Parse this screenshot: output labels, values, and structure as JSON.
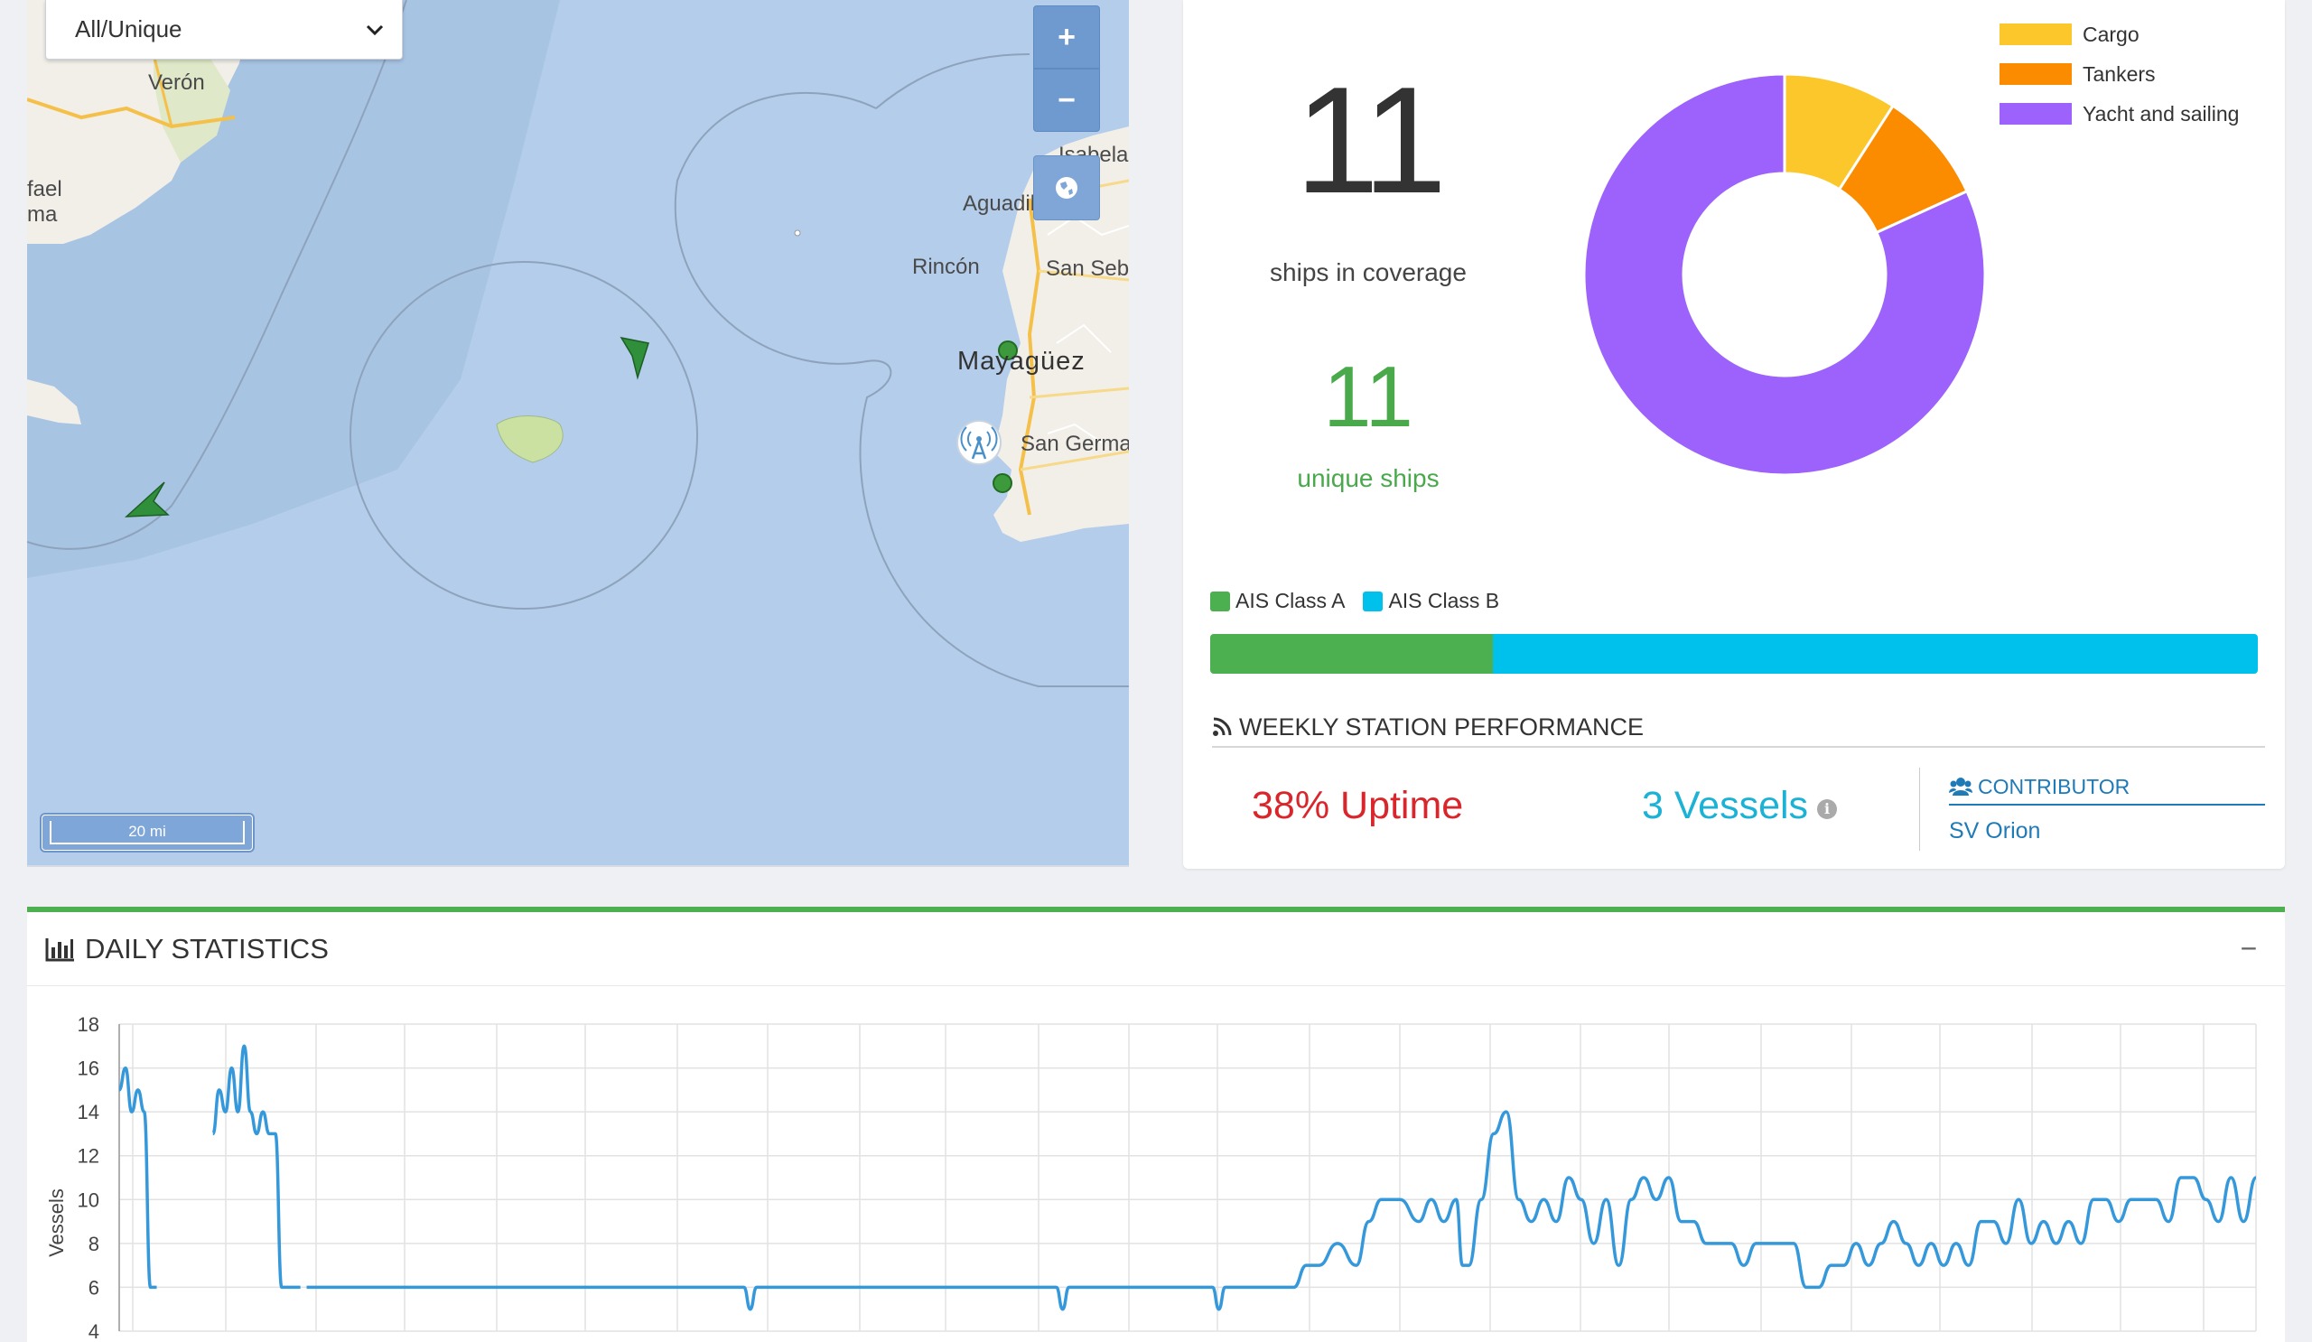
{
  "map": {
    "filter": {
      "selected": "All/Unique"
    },
    "zoom_in_label": "+",
    "zoom_out_label": "−",
    "scale_label": "20 mi",
    "place_labels": {
      "veron": "Verón",
      "fael": "fael",
      "ma": "ma",
      "isabela": "Isabela",
      "aguadilla": "Aguadilla",
      "rincon": "Rincón",
      "san_seb": "San Seb",
      "mayaguez": "Mayagüez",
      "san_germ": "San Germa"
    },
    "colors": {
      "water": "#b3cdeb",
      "land": "#f2efe9",
      "vessel": "#3c9a3c"
    }
  },
  "coverage": {
    "ships_count": "11",
    "ships_label": "ships in coverage",
    "unique_count": "11",
    "unique_label": "unique ships"
  },
  "vessel_types": {
    "legend": [
      {
        "label": "Cargo",
        "color": "#fcc72a"
      },
      {
        "label": "Tankers",
        "color": "#fb8c00"
      },
      {
        "label": "Yacht and sailing",
        "color": "#9d62fb"
      }
    ],
    "values": [
      1,
      1,
      9
    ]
  },
  "ais_classes": {
    "class_a": {
      "label": "AIS Class A",
      "color": "#4caf50",
      "fraction": 0.27
    },
    "class_b": {
      "label": "AIS Class B",
      "color": "#00c0ec",
      "fraction": 0.73
    }
  },
  "performance": {
    "title": "WEEKLY STATION PERFORMANCE",
    "uptime": "38% Uptime",
    "vessels": "3 Vessels",
    "contributor_title": "CONTRIBUTOR",
    "contributor_name": "SV Orion"
  },
  "daily": {
    "title": "DAILY STATISTICS",
    "collapse_label": "−"
  },
  "chart_data": {
    "type": "line",
    "title": "",
    "xlabel": "",
    "ylabel": "Vessels",
    "ylim": [
      4,
      18
    ],
    "yticks": [
      4,
      6,
      8,
      10,
      12,
      14,
      16,
      18
    ],
    "grid": true,
    "color": "#3498db",
    "series": [
      {
        "x": [
          0,
          1,
          2,
          3,
          4,
          5,
          6
        ],
        "y": [
          15,
          16,
          14,
          15,
          14,
          6,
          6
        ]
      },
      {
        "x": [
          15,
          16,
          17,
          18,
          19,
          20,
          21,
          22,
          23,
          24,
          25,
          26,
          27,
          28,
          29
        ],
        "y": [
          13,
          15,
          14,
          16,
          14,
          17,
          14,
          13,
          14,
          13,
          13,
          6,
          6,
          6,
          6
        ]
      },
      {
        "x": [
          30,
          80,
          100,
          101,
          102,
          120,
          150,
          151,
          152,
          170,
          175,
          176,
          177,
          180,
          185,
          188,
          190,
          192,
          195,
          198,
          200,
          202,
          205,
          208,
          210,
          212,
          214,
          215,
          216,
          218,
          220,
          222,
          224,
          226,
          228,
          230,
          232,
          234,
          236,
          238,
          240,
          242,
          244,
          246,
          248,
          250,
          252,
          254,
          256,
          258,
          260,
          262,
          264,
          266,
          268,
          270,
          272,
          274,
          276,
          278,
          280,
          282,
          284,
          286,
          288,
          290,
          292,
          294,
          296,
          298,
          300,
          302,
          304,
          306,
          308,
          310,
          312,
          314,
          316,
          318,
          320,
          322,
          324,
          326,
          328,
          330,
          332,
          334,
          336,
          338,
          340,
          342
        ],
        "y": [
          6,
          6,
          6,
          5,
          6,
          6,
          6,
          5,
          6,
          6,
          6,
          5,
          6,
          6,
          6,
          6,
          7,
          7,
          8,
          7,
          9,
          10,
          10,
          9,
          10,
          9,
          10,
          7,
          7,
          10,
          13,
          14,
          10,
          9,
          10,
          9,
          11,
          10,
          8,
          10,
          7,
          10,
          11,
          10,
          11,
          9,
          9,
          8,
          8,
          8,
          7,
          8,
          8,
          8,
          8,
          6,
          6,
          7,
          7,
          8,
          7,
          8,
          9,
          8,
          7,
          8,
          7,
          8,
          7,
          9,
          9,
          8,
          10,
          8,
          9,
          8,
          9,
          8,
          10,
          10,
          9,
          10,
          10,
          10,
          9,
          11,
          11,
          10,
          9,
          11,
          9,
          11
        ]
      }
    ],
    "xmax": 342
  }
}
